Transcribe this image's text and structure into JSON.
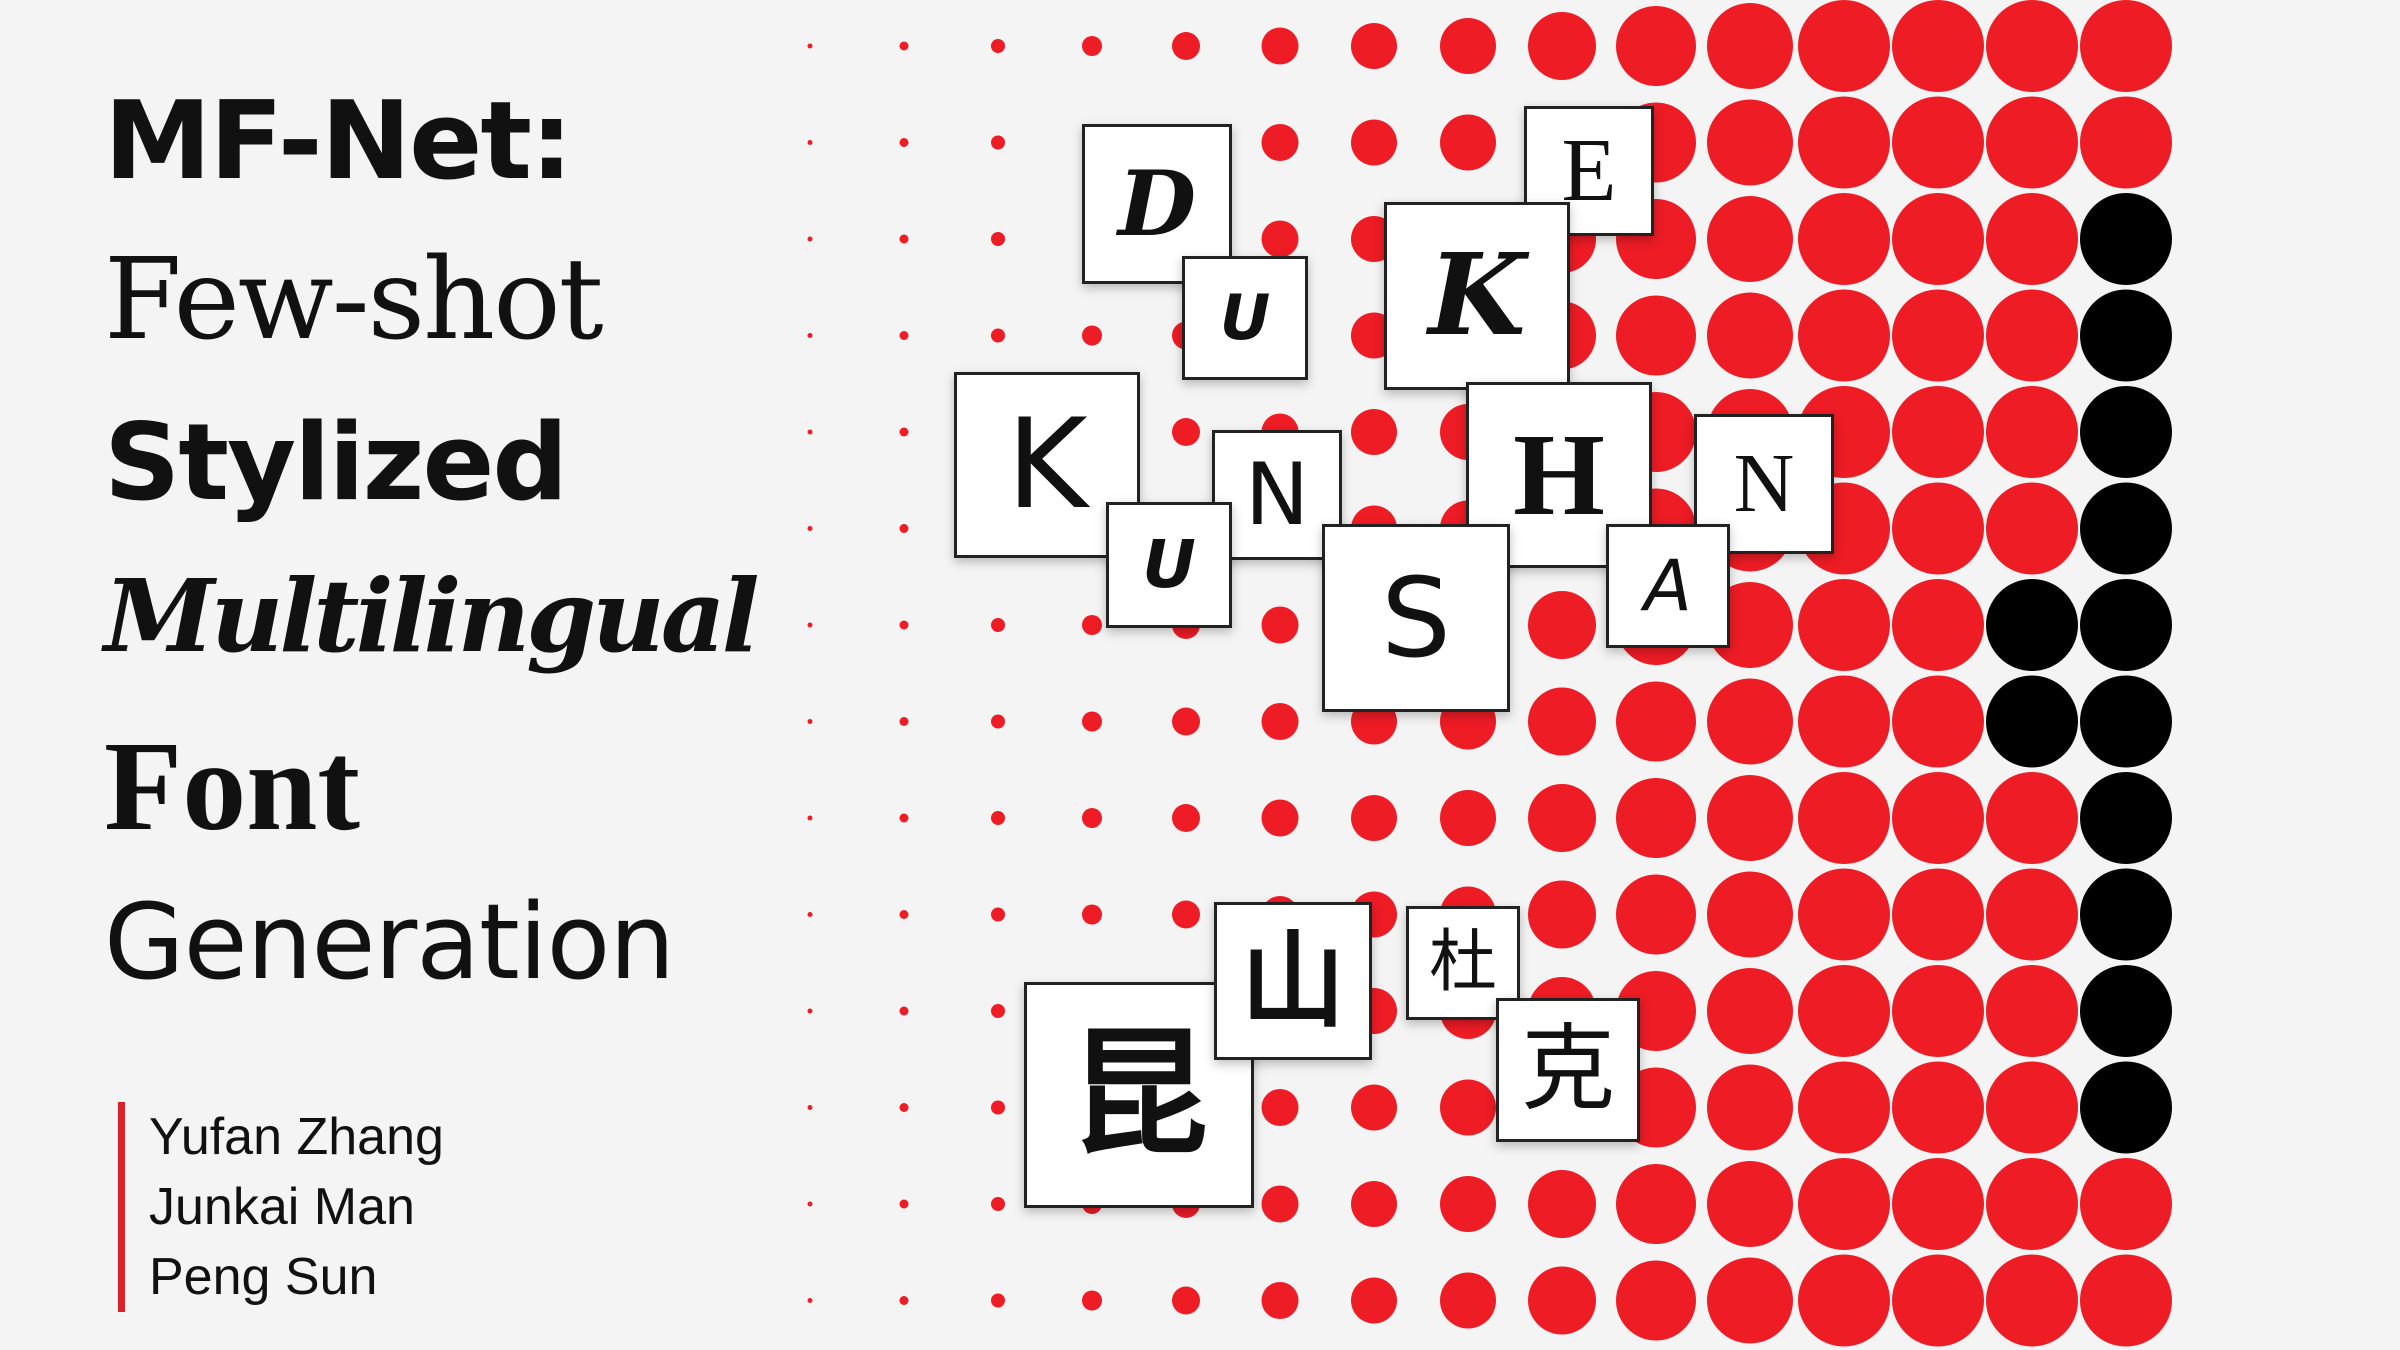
{
  "title": {
    "line1": "MF-Net:",
    "line2": "Few-shot",
    "line3": "Stylized",
    "line4": "Multilingual",
    "line5": "Font",
    "line6": "Generation"
  },
  "authors": [
    "Yufan Zhang",
    "Junkai Man",
    "Peng Sun"
  ],
  "tiles": {
    "d": "D",
    "e": "E",
    "u1": "U",
    "k1": "K",
    "k2": "K",
    "n1": "N",
    "h": "H",
    "n2": "N",
    "u2": "U",
    "s": "S",
    "a": "A",
    "kun": "昆",
    "shan": "山",
    "du": "杜",
    "ke": "克"
  },
  "colors": {
    "background": "#f4f4f4",
    "accent_red": "#ee1c25",
    "dot_black": "#000000",
    "text": "#111111"
  }
}
